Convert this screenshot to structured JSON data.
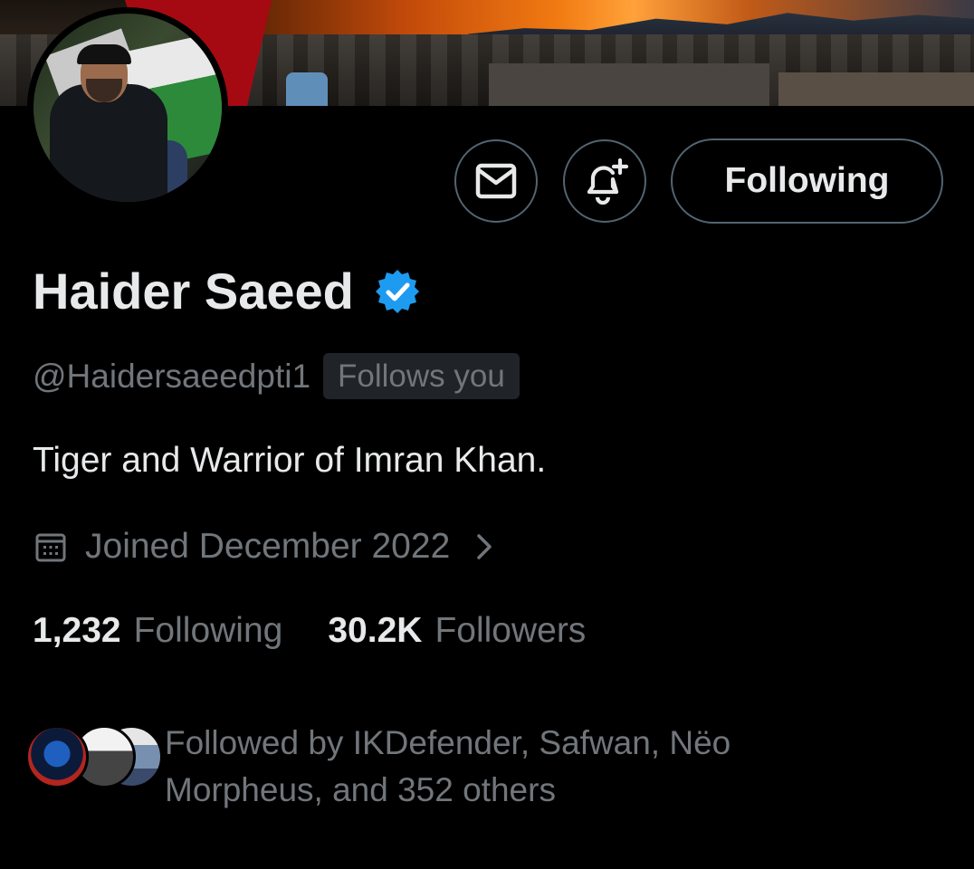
{
  "profile": {
    "name": "Haider Saeed",
    "handle": "@Haidersaeedpti1",
    "follows_you": "Follows you",
    "bio": "Tiger and Warrior of Imran Khan.",
    "joined": "Joined December 2022",
    "verified": true
  },
  "actions": {
    "message_icon": "envelope-icon",
    "notify_icon": "bell-plus-icon",
    "follow_label": "Following"
  },
  "stats": {
    "following_count": "1,232",
    "following_label": "Following",
    "followers_count": "30.2K",
    "followers_label": "Followers"
  },
  "followed_by": {
    "text_line1": "Followed by IKDefender, Safwan, Nëo",
    "text_line2": "Morpheus, and 352 others"
  },
  "colors": {
    "background": "#000000",
    "text_primary": "#e7e9ea",
    "text_secondary": "#71767b",
    "border": "#536471",
    "verified_blue": "#1d9bf0"
  }
}
